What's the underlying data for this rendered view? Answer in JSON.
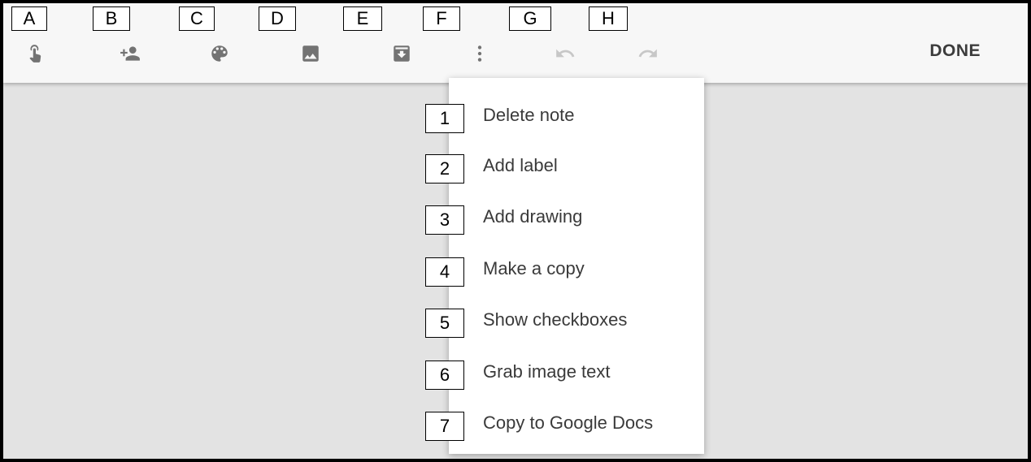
{
  "toolbar": {
    "done_label": "DONE",
    "tools": [
      {
        "letter": "A",
        "icon": "reminder-icon"
      },
      {
        "letter": "B",
        "icon": "add-collaborator-icon"
      },
      {
        "letter": "C",
        "icon": "palette-icon"
      },
      {
        "letter": "D",
        "icon": "image-icon"
      },
      {
        "letter": "E",
        "icon": "archive-icon"
      },
      {
        "letter": "F",
        "icon": "more-vert-icon"
      },
      {
        "letter": "G",
        "icon": "undo-icon"
      },
      {
        "letter": "H",
        "icon": "redo-icon"
      }
    ]
  },
  "menu": {
    "items": [
      {
        "num": "1",
        "label": "Delete note"
      },
      {
        "num": "2",
        "label": "Add label"
      },
      {
        "num": "3",
        "label": "Add drawing"
      },
      {
        "num": "4",
        "label": "Make a copy"
      },
      {
        "num": "5",
        "label": "Show checkboxes"
      },
      {
        "num": "6",
        "label": "Grab image text"
      },
      {
        "num": "7",
        "label": "Copy to Google Docs"
      }
    ]
  },
  "colors": {
    "toolbar_bg": "#f7f7f7",
    "canvas_bg": "#e3e3e3",
    "icon": "#737373",
    "icon_disabled": "#c7c7c7"
  }
}
